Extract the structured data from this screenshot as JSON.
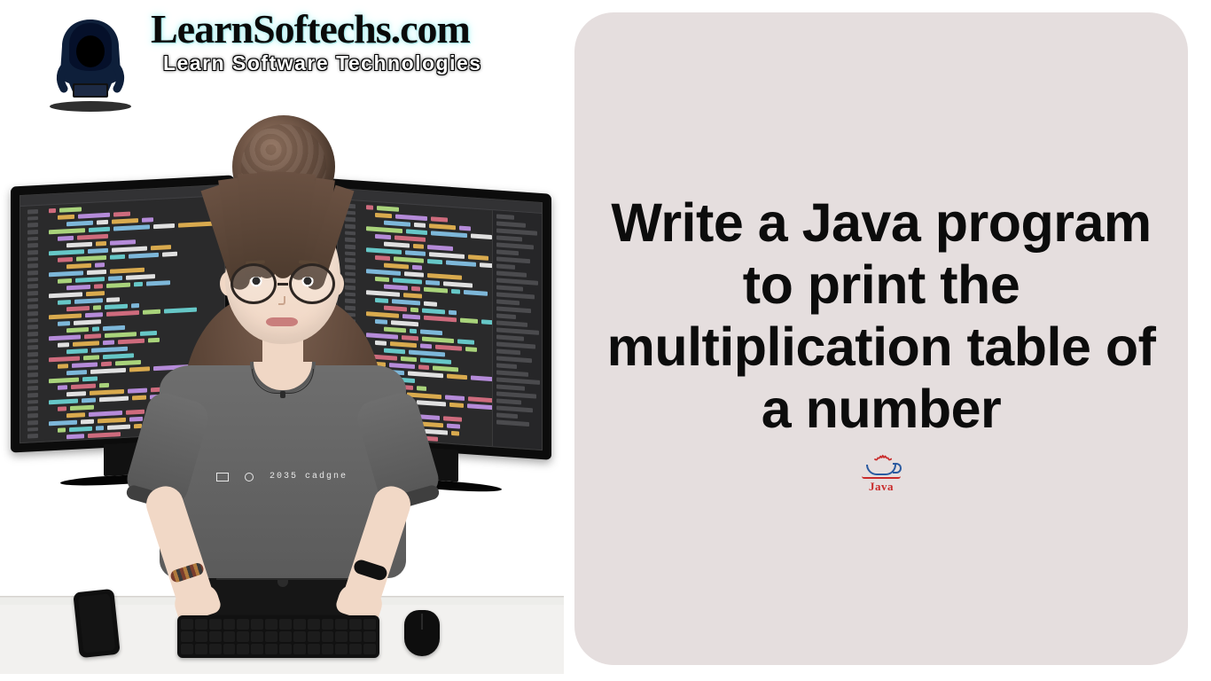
{
  "brand": {
    "name": "LearnSoftechs.com",
    "tagline": "Learn Software Technologies"
  },
  "card": {
    "headline": "Write a Java program to print the multiplication table of a number",
    "logo_label": "Java"
  },
  "scene": {
    "shirt_print": "2035  cadgne"
  }
}
